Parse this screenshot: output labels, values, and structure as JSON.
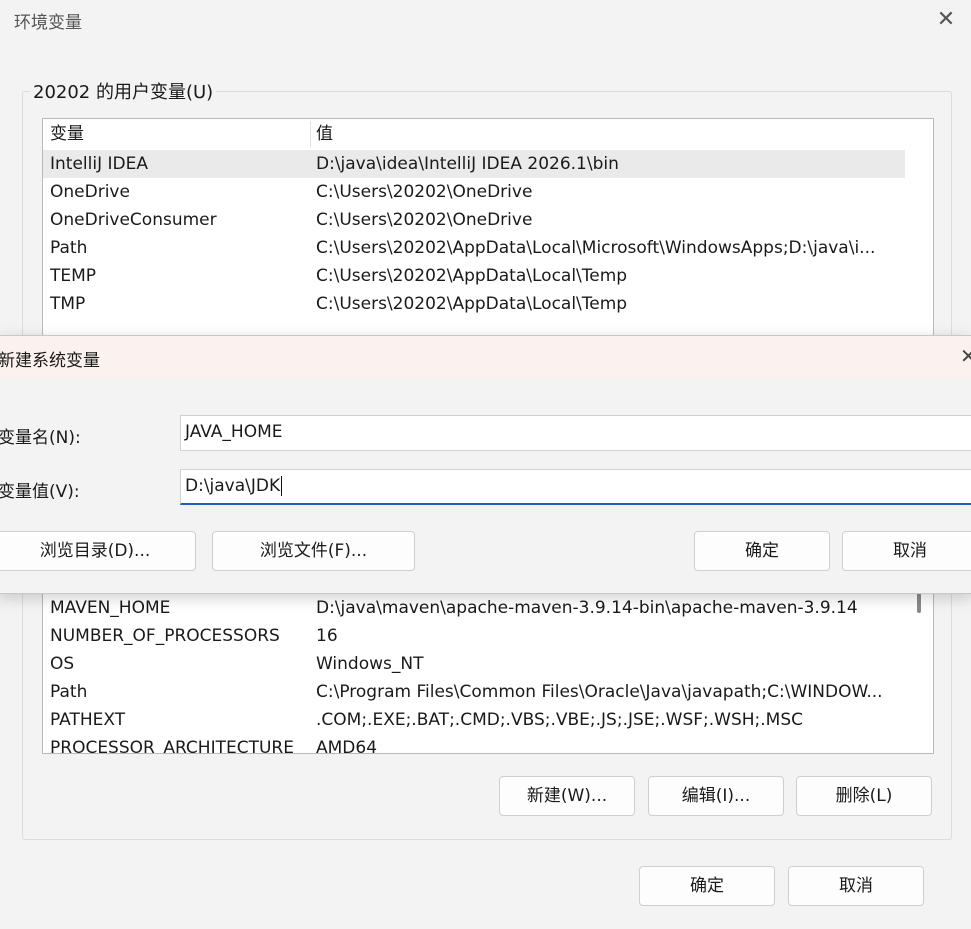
{
  "main": {
    "title": "环境变量",
    "user_group_label": "20202 的用户变量(U)",
    "columns": {
      "name": "变量",
      "value": "值"
    },
    "user_vars": [
      {
        "name": "IntelliJ IDEA",
        "value": "D:\\java\\idea\\IntelliJ IDEA 2026.1\\bin"
      },
      {
        "name": "OneDrive",
        "value": "C:\\Users\\20202\\OneDrive"
      },
      {
        "name": "OneDriveConsumer",
        "value": "C:\\Users\\20202\\OneDrive"
      },
      {
        "name": "Path",
        "value": "C:\\Users\\20202\\AppData\\Local\\Microsoft\\WindowsApps;D:\\java\\i..."
      },
      {
        "name": "TEMP",
        "value": "C:\\Users\\20202\\AppData\\Local\\Temp"
      },
      {
        "name": "TMP",
        "value": "C:\\Users\\20202\\AppData\\Local\\Temp"
      }
    ],
    "sys_vars": [
      {
        "name": "MAVEN_HOME",
        "value": "D:\\java\\maven\\apache-maven-3.9.14-bin\\apache-maven-3.9.14"
      },
      {
        "name": "NUMBER_OF_PROCESSORS",
        "value": "16"
      },
      {
        "name": "OS",
        "value": "Windows_NT"
      },
      {
        "name": "Path",
        "value": "C:\\Program Files\\Common Files\\Oracle\\Java\\javapath;C:\\WINDOW..."
      },
      {
        "name": "PATHEXT",
        "value": ".COM;.EXE;.BAT;.CMD;.VBS;.VBE;.JS;.JSE;.WSF;.WSH;.MSC"
      },
      {
        "name": "PROCESSOR_ARCHITECTURE",
        "value": "AMD64"
      }
    ],
    "sys_buttons": {
      "new": "新建(W)...",
      "edit": "编辑(I)...",
      "delete": "删除(L)"
    },
    "ok": "确定",
    "cancel": "取消"
  },
  "dialog": {
    "title": "新建系统变量",
    "name_label": "变量名(N):",
    "value_label": "变量值(V):",
    "name_value": "JAVA_HOME",
    "value_value": "D:\\java\\JDK",
    "browse_dir": "浏览目录(D)...",
    "browse_file": "浏览文件(F)...",
    "ok": "确定",
    "cancel": "取消"
  },
  "icons": {
    "close": "close-icon"
  }
}
